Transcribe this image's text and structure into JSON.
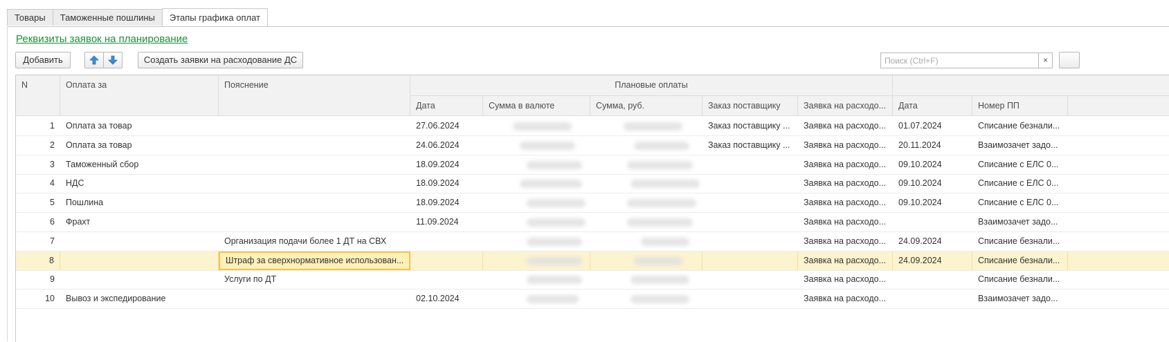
{
  "tabs": [
    {
      "label": "Товары",
      "active": false
    },
    {
      "label": "Таможенные пошлины",
      "active": false
    },
    {
      "label": "Этапы графика оплат",
      "active": true
    }
  ],
  "link": "Реквизиты заявок на планирование",
  "toolbar": {
    "add_label": "Добавить",
    "create_label": "Создать заявки на расходование ДС",
    "up_icon": "arrow-up-icon",
    "down_icon": "arrow-down-icon"
  },
  "search": {
    "placeholder": "Поиск (Ctrl+F)",
    "clear_label": "×"
  },
  "table": {
    "headers": {
      "n": "N",
      "pay_for": "Оплата за",
      "note": "Пояснение",
      "group": "Плановые оплаты",
      "date": "Дата",
      "sum_cur": "Сумма в валюте",
      "sum_rub": "Сумма, руб.",
      "order": "Заказ поставщику",
      "request": "Заявка на расходо...",
      "date2": "Дата",
      "pp": "Номер ПП"
    },
    "rows": [
      {
        "n": "1",
        "pay_for": "Оплата за товар",
        "note": "",
        "date": "27.06.2024",
        "order": "Заказ поставщику ...",
        "request": "Заявка на расходо...",
        "date2": "01.07.2024",
        "pp": "Списание безнали..."
      },
      {
        "n": "2",
        "pay_for": "Оплата за товар",
        "note": "",
        "date": "24.06.2024",
        "order": "Заказ поставщику ...",
        "request": "Заявка на расходо...",
        "date2": "20.11.2024",
        "pp": "Взаимозачет задо..."
      },
      {
        "n": "3",
        "pay_for": "Таможенный сбор",
        "note": "",
        "date": "18.09.2024",
        "order": "",
        "request": "Заявка на расходо...",
        "date2": "09.10.2024",
        "pp": "Списание с ЕЛС 0..."
      },
      {
        "n": "4",
        "pay_for": "НДС",
        "note": "",
        "date": "18.09.2024",
        "order": "",
        "request": "Заявка на расходо...",
        "date2": "09.10.2024",
        "pp": "Списание с ЕЛС 0..."
      },
      {
        "n": "5",
        "pay_for": "Пошлина",
        "note": "",
        "date": "18.09.2024",
        "order": "",
        "request": "Заявка на расходо...",
        "date2": "09.10.2024",
        "pp": "Списание с ЕЛС 0..."
      },
      {
        "n": "6",
        "pay_for": "Фрахт",
        "note": "",
        "date": "11.09.2024",
        "order": "",
        "request": "Заявка на расходо...",
        "date2": "",
        "pp": "Взаимозачет задо..."
      },
      {
        "n": "7",
        "pay_for": "",
        "note": "Организация подачи более 1 ДТ на СВХ",
        "date": "",
        "order": "",
        "request": "Заявка на расходо...",
        "date2": "24.09.2024",
        "pp": "Списание безнали..."
      },
      {
        "n": "8",
        "pay_for": "",
        "note": "Штраф за сверхнормативное использован...",
        "date": "",
        "order": "",
        "request": "Заявка на расходо...",
        "date2": "24.09.2024",
        "pp": "Списание безнали..."
      },
      {
        "n": "9",
        "pay_for": "",
        "note": "Услуги по ДТ",
        "date": "",
        "order": "",
        "request": "Заявка на расходо...",
        "date2": "",
        "pp": "Списание безнали..."
      },
      {
        "n": "10",
        "pay_for": "Вывоз и экспедирование",
        "note": "",
        "date": "02.10.2024",
        "order": "",
        "request": "Заявка на расходо...",
        "date2": "",
        "pp": "Взаимозачет задо..."
      }
    ]
  },
  "colors": {
    "accent_link": "#1d8d3c",
    "selected_row": "#fcf3cf",
    "focus_border": "#f1c54a"
  }
}
